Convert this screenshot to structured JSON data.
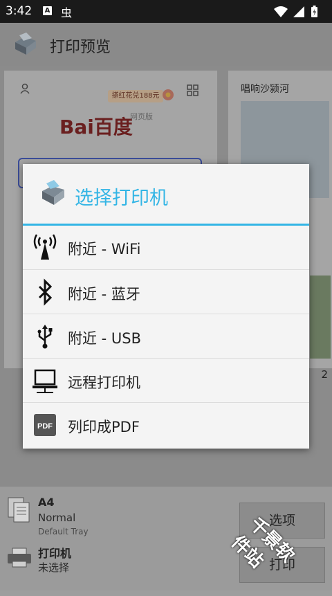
{
  "status_bar": {
    "time": "3:42",
    "icon_a": "A",
    "icon_bug": "虫"
  },
  "app_bar": {
    "title": "打印预览"
  },
  "preview": {
    "page1": {
      "promo": "搽红花兑188元",
      "logo": "Bai百度",
      "logo_note": "网页版"
    },
    "page2": {
      "headline": "唱响沙颍河"
    },
    "page_number": "2"
  },
  "bottom": {
    "paper_size": "A4",
    "paper_type": "Normal",
    "paper_tray": "Default Tray",
    "printer_label": "打印机",
    "printer_status": "未选择",
    "options_button": "选项",
    "print_button": "打印"
  },
  "dialog": {
    "title": "选择打印机",
    "options": [
      {
        "label": "附近 - WiFi",
        "icon": "wifi-antenna-icon"
      },
      {
        "label": "附近 - 蓝牙",
        "icon": "bluetooth-icon"
      },
      {
        "label": "附近 - USB",
        "icon": "usb-icon"
      },
      {
        "label": "远程打印机",
        "icon": "computer-icon"
      },
      {
        "label": "列印成PDF",
        "icon": "pdf-icon"
      }
    ]
  },
  "watermark": "千景软件站",
  "colors": {
    "accent": "#33b5e5",
    "dialog_bg": "#f4f4f4",
    "dim_bg": "#9e9e9e"
  }
}
